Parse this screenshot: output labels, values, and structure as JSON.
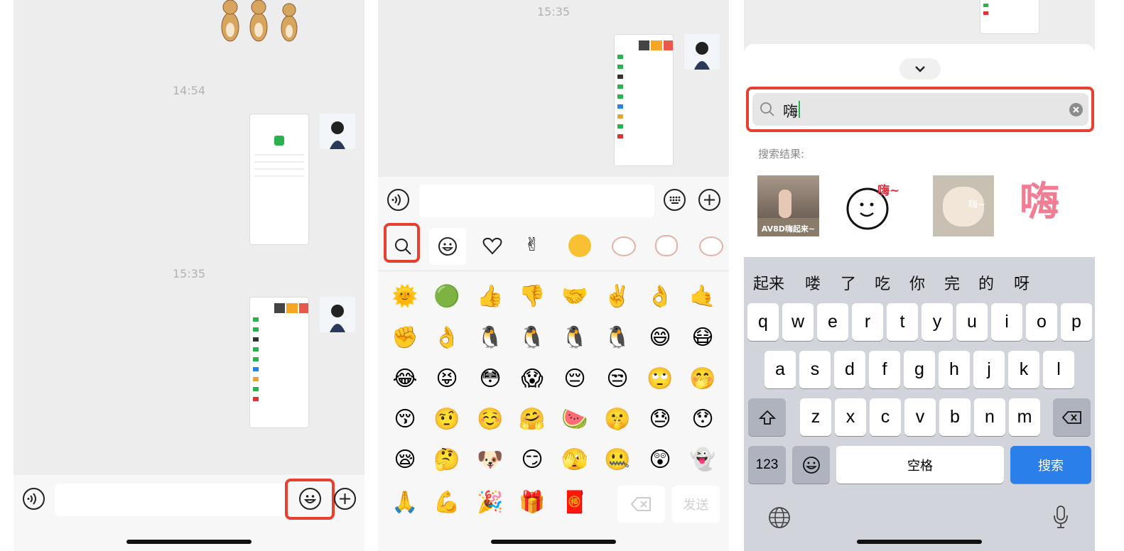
{
  "panel1": {
    "timestamps": [
      "14:54",
      "15:35"
    ],
    "input_placeholder": "",
    "icons": {
      "voice": "voice-icon",
      "emoji": "emoji-icon",
      "plus": "plus-icon"
    }
  },
  "panel2": {
    "timestamp": "15:35",
    "send_label": "发送",
    "sticker_tabs": [
      "search-icon",
      "emoji-icon",
      "heart-icon",
      "victory-hand-icon",
      "face-sticker-icon",
      "cat-sticker-1",
      "cat-sticker-2",
      "cat-sticker-3"
    ],
    "emoji_rows": [
      [
        "🌞",
        "🟢",
        "👍",
        "👎",
        "🤝",
        "✌️",
        "👌",
        "🤙"
      ],
      [
        "✊",
        "👌",
        "🐧",
        "🐧",
        "🐧",
        "🐧",
        "😄",
        "😷"
      ],
      [
        "😂",
        "😝",
        "😳",
        "😱",
        "😔",
        "😒",
        "🙄",
        "🤭"
      ],
      [
        "😚",
        "🤨",
        "☺️",
        "🤗",
        "🍉",
        "🤫",
        "😓",
        "😯"
      ],
      [
        "😪",
        "🤔",
        "🐶",
        "😏",
        "🫣",
        "🤐",
        "😲",
        "👻"
      ],
      [
        "🙏",
        "💪",
        "🎉",
        "🎁",
        "🧧"
      ]
    ]
  },
  "panel3": {
    "search_value": "嗨",
    "results_label": "搜索结果:",
    "results": [
      {
        "caption": "AV8D嗨起来~"
      },
      {
        "caption": "嗨~"
      },
      {
        "caption": "嗨~"
      },
      {
        "caption": "嗨"
      }
    ],
    "candidates": [
      "起来",
      "喽",
      "了",
      "吃",
      "你",
      "完",
      "的",
      "呀"
    ],
    "row1": [
      "q",
      "w",
      "e",
      "r",
      "t",
      "y",
      "u",
      "i",
      "o",
      "p"
    ],
    "row2": [
      "a",
      "s",
      "d",
      "f",
      "g",
      "h",
      "j",
      "k",
      "l"
    ],
    "row3": [
      "z",
      "x",
      "c",
      "v",
      "b",
      "n",
      "m"
    ],
    "numbers_key": "123",
    "space_key": "空格",
    "search_key": "搜索",
    "accent": "#2b7fe9",
    "highlight": "#e8402f"
  }
}
